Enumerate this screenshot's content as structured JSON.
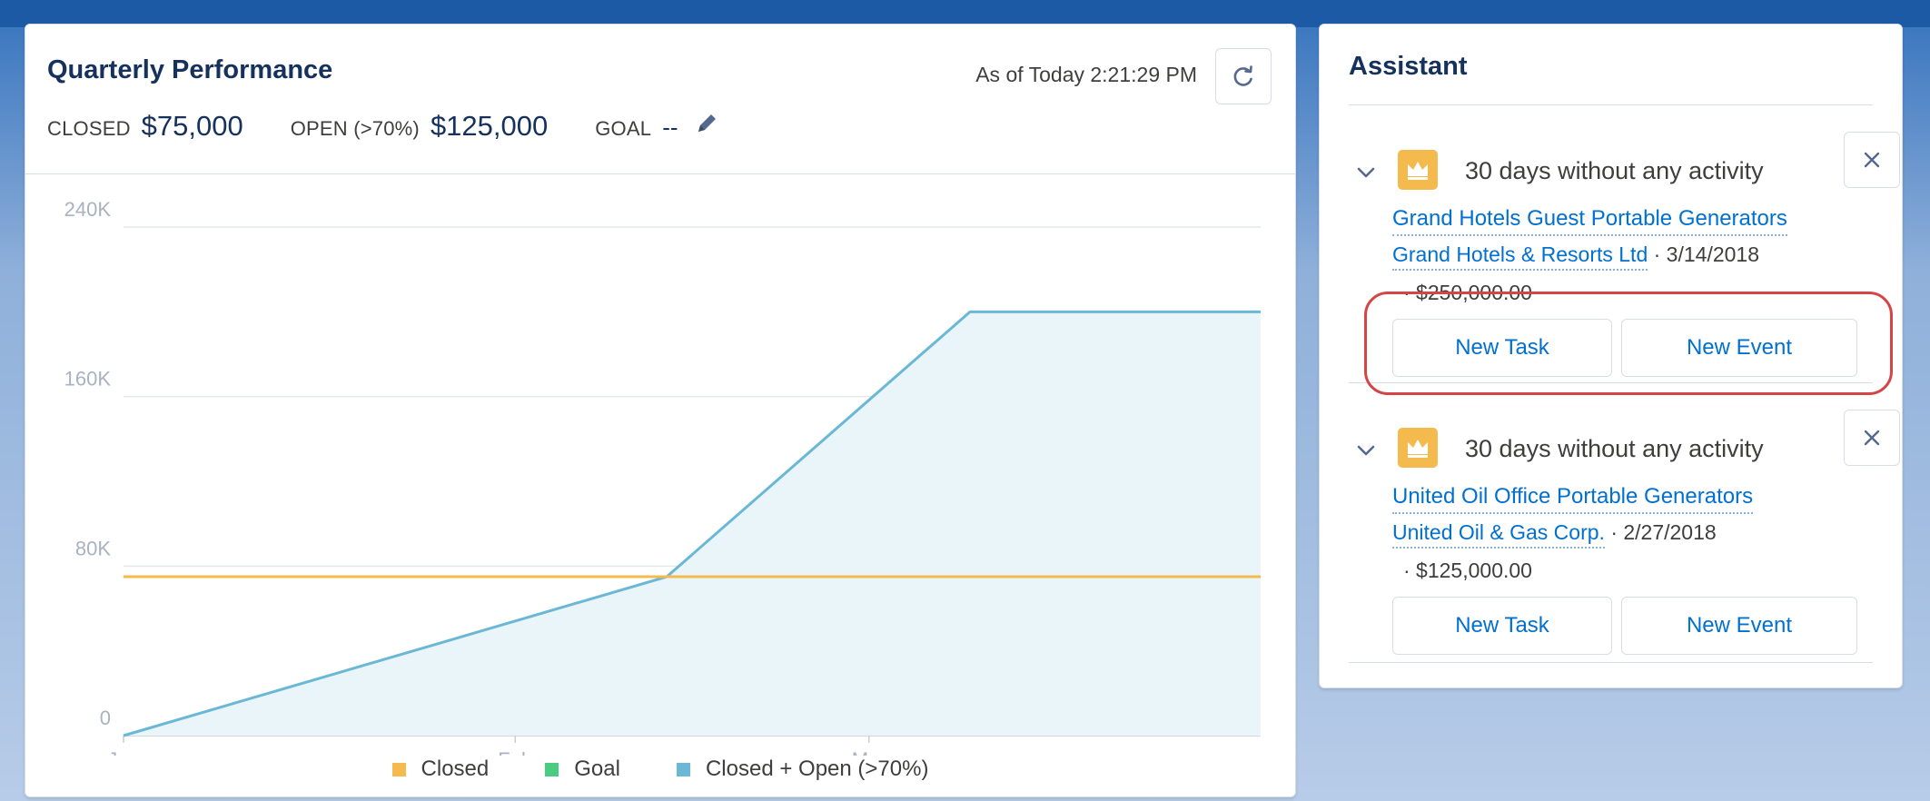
{
  "quarterly": {
    "title": "Quarterly Performance",
    "as_of": "As of Today 2:21:29 PM",
    "closed_label": "CLOSED",
    "closed_value": "$75,000",
    "open_label": "OPEN (>70%)",
    "open_value": "$125,000",
    "goal_label": "GOAL",
    "goal_value": "--"
  },
  "chart_data": {
    "type": "area",
    "title": "",
    "xlabel": "",
    "ylabel": "",
    "x_ticks": [
      "Jan",
      "Feb",
      "Mar"
    ],
    "y_ticks": [
      "240K",
      "160K",
      "80K",
      "0"
    ],
    "ylim": [
      0,
      240000
    ],
    "x_domain": [
      "2018-01-01",
      "2018-04-01"
    ],
    "grid": true,
    "legend": "bottom",
    "series": [
      {
        "name": "Closed",
        "color": "#f4ba4d",
        "points": [
          [
            "2018-01-01",
            75000
          ],
          [
            "2018-04-01",
            75000
          ]
        ]
      },
      {
        "name": "Goal",
        "color": "#4bca81",
        "points": []
      },
      {
        "name": "Closed + Open (>70%)",
        "color": "#6ab8d6",
        "fill": "#eaf5fa",
        "points": [
          [
            "2018-01-01",
            0
          ],
          [
            "2018-02-13",
            75000
          ],
          [
            "2018-03-09",
            200000
          ],
          [
            "2018-04-01",
            200000
          ]
        ]
      }
    ]
  },
  "assistant": {
    "title": "Assistant",
    "items": [
      {
        "heading": "30 days without any activity",
        "opportunity": "Grand Hotels Guest Portable Generators",
        "account": "Grand Hotels & Resorts Ltd",
        "date": "· 3/14/2018",
        "amount": "· $250,000.00",
        "new_task": "New Task",
        "new_event": "New Event"
      },
      {
        "heading": "30 days without any activity",
        "opportunity": "United Oil Office Portable Generators",
        "account": "United Oil & Gas Corp.",
        "date": "· 2/27/2018",
        "amount": "· $125,000.00",
        "new_task": "New Task",
        "new_event": "New Event"
      }
    ]
  },
  "colors": {
    "link": "#0070d2",
    "highlight": "#d64545",
    "crown_badge": "#f4ba4d"
  },
  "icons": {
    "refresh": "refresh-icon",
    "edit": "pencil-icon",
    "expand": "chevron-down-icon",
    "badge": "crown-icon",
    "dismiss": "close-icon"
  }
}
